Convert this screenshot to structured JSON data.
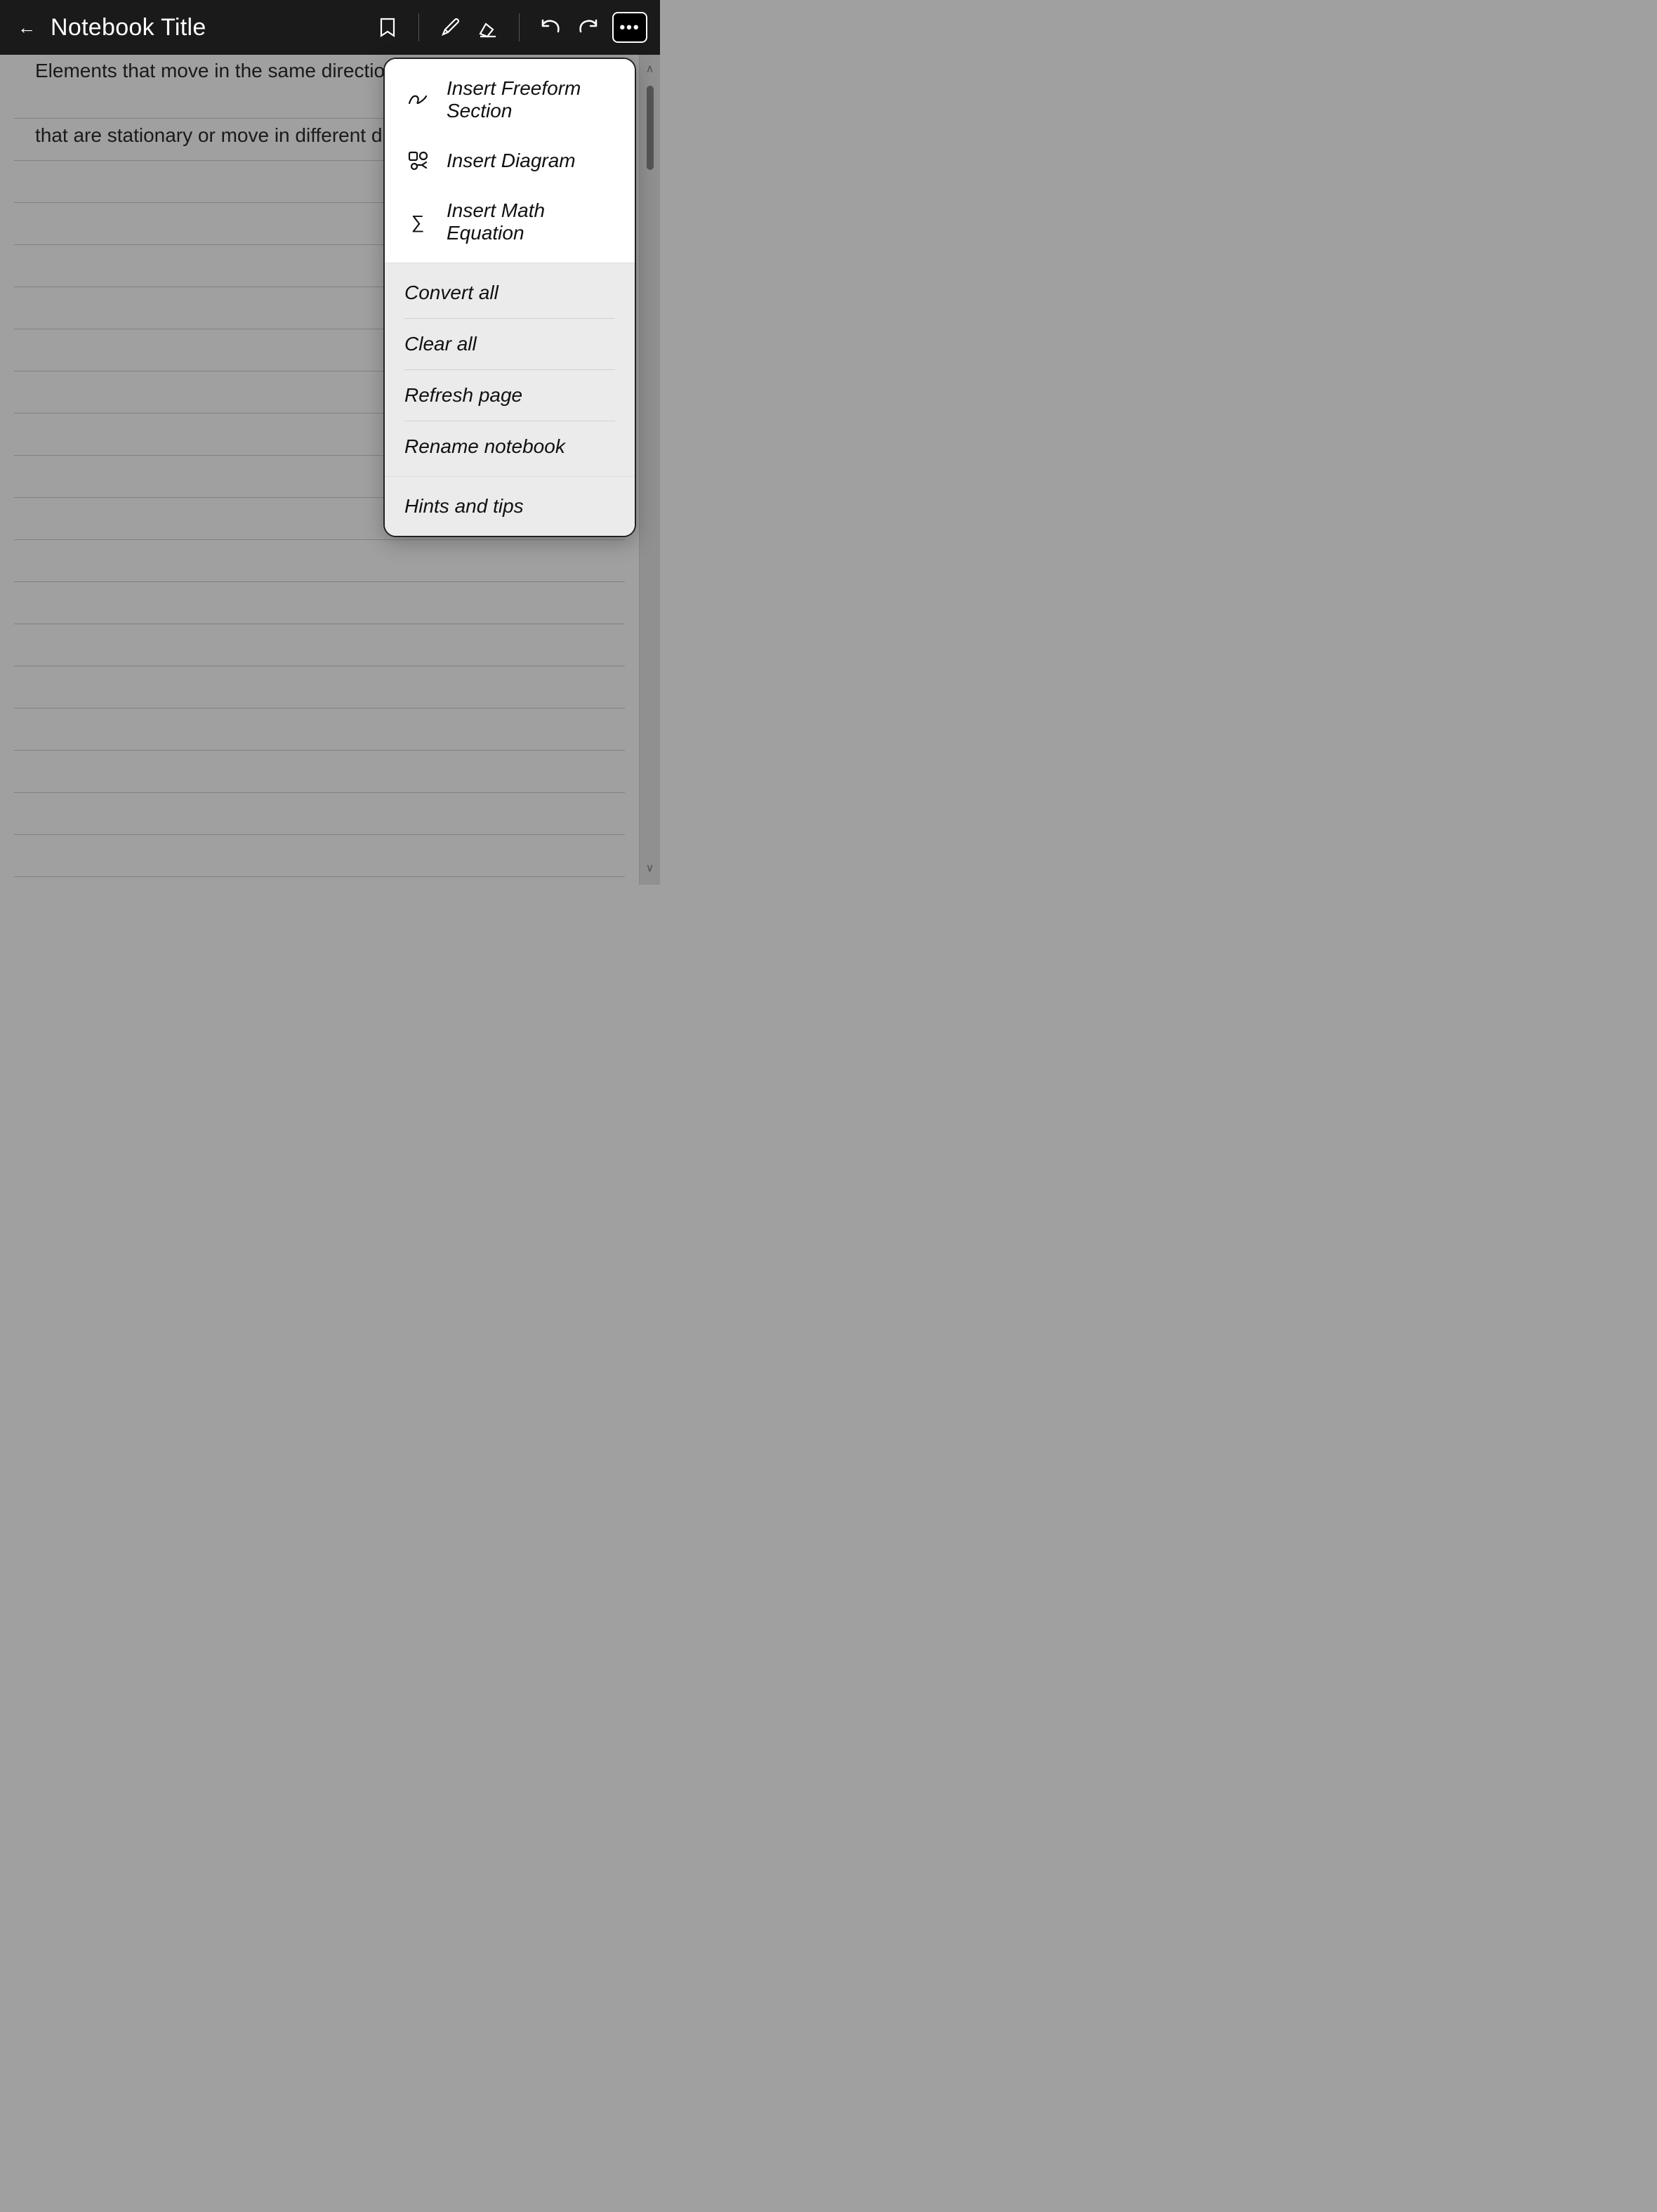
{
  "header": {
    "back_label": "←",
    "title": "Notebook Title",
    "tools": {
      "bookmark_icon": "♦",
      "pen_icon": "✎",
      "eraser_icon": "◇",
      "undo_icon": "↩",
      "redo_icon": "↪",
      "more_icon": "•••"
    }
  },
  "notebook": {
    "text_line1": "Elements that move in the same direction are perc",
    "text_line2": "that are stationary or move in different directions."
  },
  "menu": {
    "insert_freeform_label": "Insert Freeform Section",
    "insert_diagram_label": "Insert Diagram",
    "insert_math_label": "Insert Math Equation",
    "convert_all_label": "Convert all",
    "clear_all_label": "Clear all",
    "refresh_page_label": "Refresh page",
    "rename_notebook_label": "Rename notebook",
    "hints_tips_label": "Hints and tips"
  },
  "scrollbar": {
    "up_arrow": "∧",
    "down_arrow": "∨"
  }
}
